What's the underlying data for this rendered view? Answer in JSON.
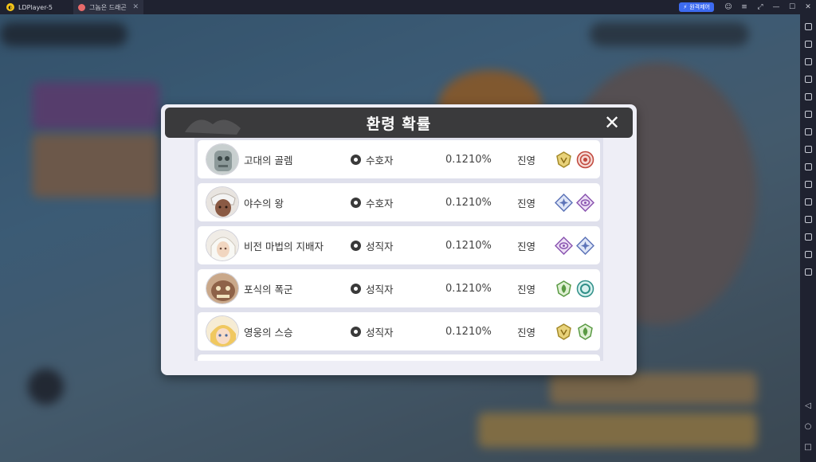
{
  "titlebar": {
    "app_name": "LDPlayer-5",
    "tab_title": "그놈은 드래곤",
    "tab_close": "✕",
    "remote_label": "원격제어",
    "controls": [
      "☺",
      "≡",
      "⤢",
      "—",
      "☐",
      "✕"
    ]
  },
  "sidebar": {
    "tools": [
      "settings-icon",
      "keyboard-icon",
      "volume-up-icon",
      "volume-down-icon",
      "screenshot-icon",
      "camera-icon",
      "install-apk-icon",
      "robot-icon",
      "scissors-icon",
      "record-icon",
      "sync-icon",
      "resize-icon",
      "folder-icon",
      "location-icon",
      "multi-window-icon"
    ],
    "nav": [
      "◁",
      "○",
      "□"
    ]
  },
  "dialog": {
    "title": "환령 확률",
    "close_label": "✕",
    "rows": [
      {
        "name": "고대의 골렘",
        "class": "수호자",
        "probability": "0.1210%",
        "camp": "진영",
        "badges": [
          "gold-crest",
          "red-spiral"
        ],
        "avatar": "golem"
      },
      {
        "name": "야수의 왕",
        "class": "수호자",
        "probability": "0.1210%",
        "camp": "진영",
        "badges": [
          "blue-star",
          "purple-eye"
        ],
        "avatar": "beast-king"
      },
      {
        "name": "비전 마법의 지배자",
        "class": "성직자",
        "probability": "0.1210%",
        "camp": "진영",
        "badges": [
          "purple-eye",
          "blue-star"
        ],
        "avatar": "arcane-master"
      },
      {
        "name": "포식의 폭군",
        "class": "성직자",
        "probability": "0.1210%",
        "camp": "진영",
        "badges": [
          "green-leaf",
          "teal-ring"
        ],
        "avatar": "tyrant"
      },
      {
        "name": "영웅의 스승",
        "class": "성직자",
        "probability": "0.1210%",
        "camp": "진영",
        "badges": [
          "gold-crest",
          "green-leaf"
        ],
        "avatar": "hero-mentor"
      }
    ]
  },
  "colors": {
    "header": "#3a3a3c",
    "dialog_bg": "#eeeef6",
    "list_bg": "#dfe0ec",
    "remote_button": "#3d6bf0"
  }
}
